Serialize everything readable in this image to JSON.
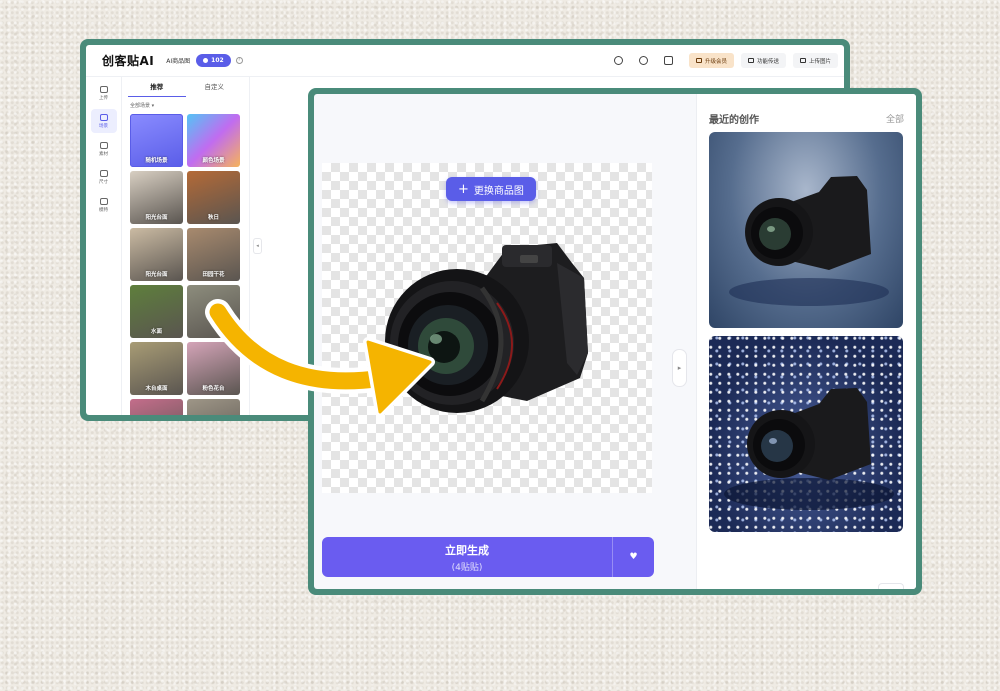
{
  "app": {
    "logo": "创客贴AI",
    "nav_label": "AI商品图",
    "points": "102"
  },
  "toolbar": {
    "upgrade_label": "升级会员",
    "feature_label": "功能传送",
    "upload_label": "上传图片"
  },
  "rail": [
    {
      "label": "上传"
    },
    {
      "label": "场景"
    },
    {
      "label": "素材"
    },
    {
      "label": "尺寸"
    },
    {
      "label": "模特"
    }
  ],
  "scene_panel": {
    "tabs": [
      "推荐",
      "自定义"
    ],
    "filter": "全部场景 ▾",
    "tiles": [
      {
        "label": "随机场景",
        "color": "#7c7ff5"
      },
      {
        "label": "颜色场景",
        "color": "#c06cf0"
      },
      {
        "label": "阳光台面",
        "color": "#d8cfc2"
      },
      {
        "label": "秋日",
        "color": "#b46a37"
      },
      {
        "label": "阳光台面",
        "color": "#cbbba3"
      },
      {
        "label": "田园干花",
        "color": "#a88a6e"
      },
      {
        "label": "水面",
        "color": "#5e7f3c"
      },
      {
        "label": "",
        "color": "#8d8d7d"
      },
      {
        "label": "木台桌面",
        "color": "#a89c75"
      },
      {
        "label": "粉色花台",
        "color": "#d4a4b8"
      },
      {
        "label": "",
        "color": "#c46d8b"
      },
      {
        "label": "",
        "color": "#9e9687"
      }
    ]
  },
  "editor": {
    "replace_button": "更换商品图",
    "generate_label": "立即生成",
    "generate_cost": "(4贴贴)"
  },
  "recent": {
    "title": "最近的创作",
    "all_link": "全部"
  },
  "colors": {
    "accent": "#5a5de8",
    "frame": "#4a8b7a",
    "arrow": "#f5b400"
  }
}
